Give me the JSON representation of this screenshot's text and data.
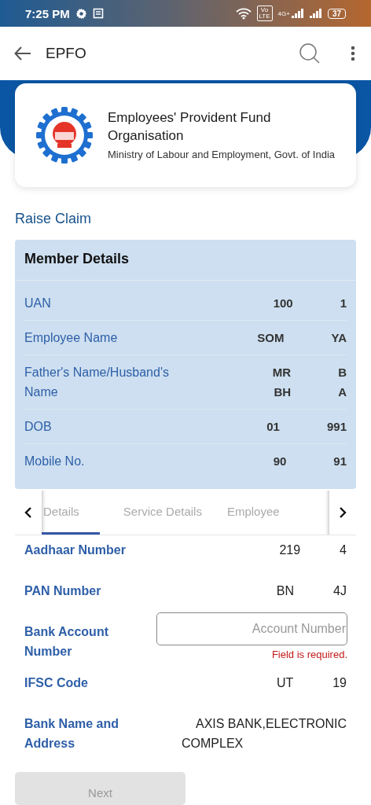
{
  "status_bar": {
    "time": "7:25 PM",
    "volte": "Vo LTE",
    "network": "4G+",
    "battery": "37"
  },
  "app_bar": {
    "title": "EPFO"
  },
  "org_card": {
    "name": "Employees' Provident Fund Organisation",
    "ministry": "Ministry of Labour and Employment, Govt. of India"
  },
  "section_title": "Raise Claim",
  "member_details": {
    "title": "Member Details",
    "rows": [
      {
        "label": "UAN",
        "value_start": "100",
        "value_end": "1"
      },
      {
        "label": "Employee Name",
        "value_start": "SOM",
        "value_end": "YA"
      },
      {
        "label": "Father's Name/Husband's Name",
        "value_start": "MR",
        "value_end": "B",
        "value2_start": "BH",
        "value2_end": "A"
      },
      {
        "label": "DOB",
        "value_start": "01",
        "value_end": "991"
      },
      {
        "label": "Mobile No.",
        "value_start": "90",
        "value_end": "91"
      }
    ]
  },
  "tabs": [
    {
      "label": "Details",
      "selected": true
    },
    {
      "label": "Service Details",
      "selected": false
    },
    {
      "label": "Employee",
      "selected": false
    }
  ],
  "form_rows": [
    {
      "kind": "text",
      "label": "Aadhaar Number",
      "value_start": "219",
      "value_end": "4"
    },
    {
      "kind": "text",
      "label": "PAN Number",
      "value_start": "BN",
      "value_end": "4J"
    },
    {
      "kind": "input",
      "label": "Bank Account Number",
      "placeholder": "Account Number",
      "error": "Field is required."
    },
    {
      "kind": "text",
      "label": "IFSC Code",
      "value_start": "UT",
      "value_end": "19"
    },
    {
      "kind": "address",
      "label": "Bank Name and Address",
      "value": "AXIS BANK,ELECTRONIC COMPLEX"
    }
  ],
  "next_button": {
    "label": "Next",
    "disabled": true
  }
}
